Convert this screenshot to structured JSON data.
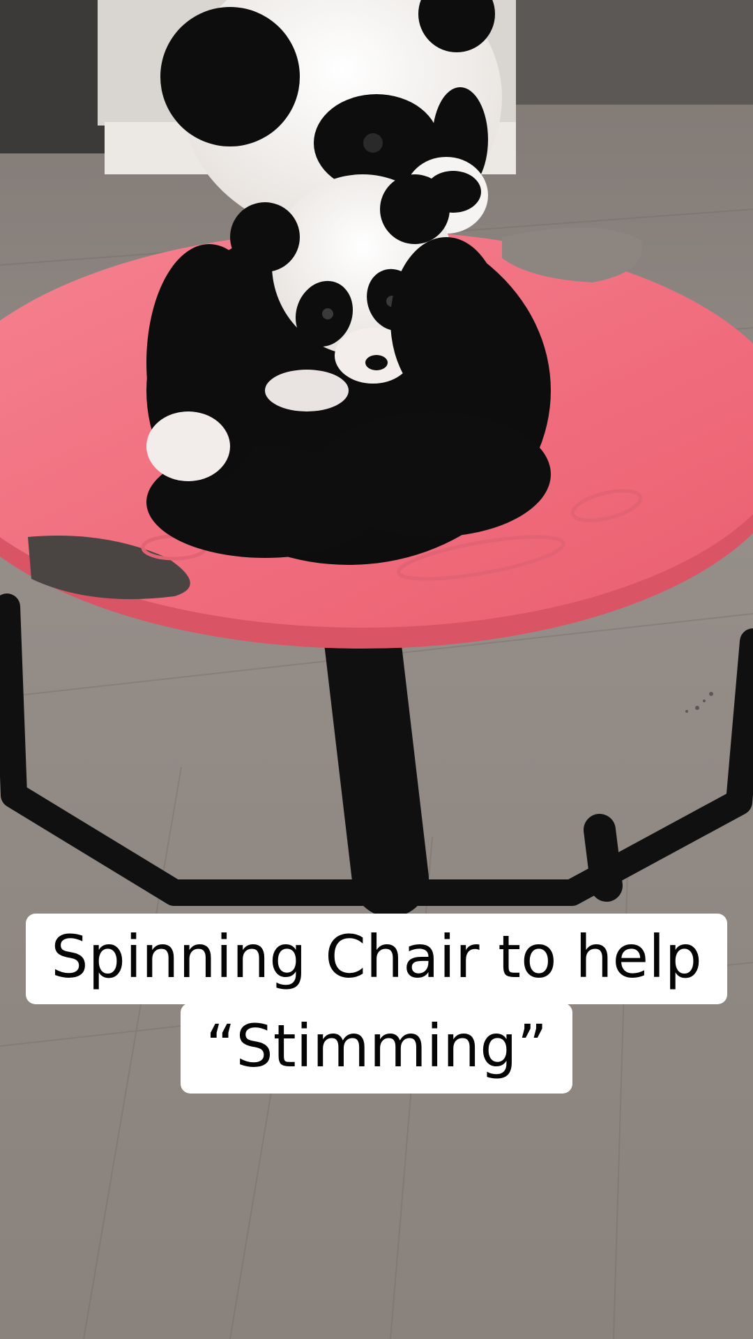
{
  "video": {
    "caption_lines": [
      "Spinning Chair to help",
      "“Stimming”"
    ]
  },
  "scene": {
    "floor_color": "#8e8680",
    "baseboard_color": "#ece9e4",
    "seat_color": "#f2707f",
    "frame_color": "#111111",
    "plush_black": "#0d0d0d",
    "plush_white": "#f6f4f2"
  }
}
